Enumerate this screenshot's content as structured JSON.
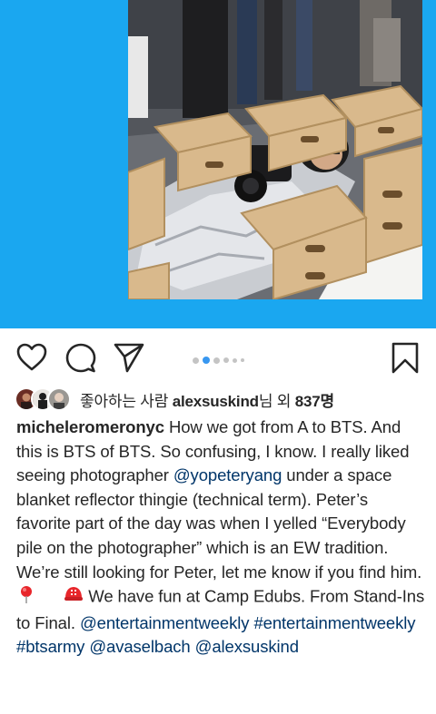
{
  "post": {
    "image_alt": "Photographer lying under a silver space blanket surrounded by wooden apple boxes",
    "carousel": {
      "count": 5,
      "active_index": 1
    }
  },
  "likes": {
    "prefix": "좋아하는 사람 ",
    "user": "alexsuskind",
    "suffix": "님 외 ",
    "count": "837명"
  },
  "caption": {
    "username": "micheleromeronyc",
    "text_1": " How we got from A to BTS. And this is BTS of BTS. So confusing, I know. I really liked seeing photographer ",
    "mention_1": "@yopeteryang",
    "text_2": " under a space blanket reflector thingie (technical term). Peter’s favorite part of the day was when I yelled “Everybody pile on the photographer” which is an EW tradition. We’re still looking for Peter, let me know if you find him. ",
    "emoji_1": "pin-emoji",
    "emoji_2": "rescue-helmet-emoji",
    "text_3": " We have fun at Camp Edubs. From Stand-Ins to Final. ",
    "mention_2": "@entertainmentweekly",
    "hashtag_1": "#entertainmentweekly",
    "hashtag_2": "#btsarmy",
    "mention_3": "@avaselbach",
    "mention_4": "@alexsuskind"
  },
  "colors": {
    "media_background": "#1aa7f0",
    "link": "#003569",
    "active_dot": "#3897f0",
    "text": "#262626"
  },
  "icons": {
    "like": "heart-icon",
    "comment": "comment-bubble-icon",
    "share": "paper-plane-icon",
    "save": "bookmark-icon"
  }
}
